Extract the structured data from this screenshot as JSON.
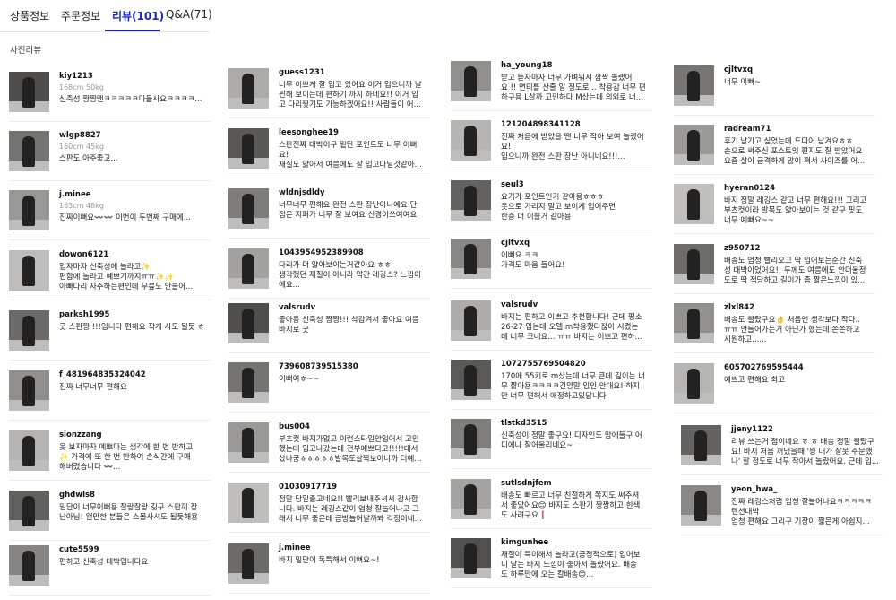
{
  "tabs": [
    {
      "label": "상품정보"
    },
    {
      "label": "주문정보"
    },
    {
      "label": "리뷰(101)"
    },
    {
      "label": "Q&A(71)"
    }
  ],
  "section_title": "사진리뷰",
  "reviews": [
    {
      "user": "kiy1213",
      "info": "168cm 50kg",
      "text": "신축성 짱짱맨ㅋㅋㅋㅋㅋ다들사요ㅋㅋㅋㅋ..."
    },
    {
      "user": "wlgp8827",
      "info": "160cm 45kg",
      "text": "스판도 아주좋고..."
    },
    {
      "user": "j.minee",
      "info": "163cm 48kg",
      "text": "진짜이뻐요〰️〰️ 이번이 두번째 구매에..."
    },
    {
      "user": "dowon6121",
      "info": "",
      "text": "입자마자 신축성에 놀라고✨\n편함에 놀라고 예쁘기까지ㅠㅠ✨✨\n아빠다리 자주하는편인데 무릎도 안늘어..."
    },
    {
      "user": "parksh1995",
      "info": "",
      "text": "굿 스판짱 !!!입니다 편해요 작게 사도 될듯 ㅎ"
    },
    {
      "user": "f_481964835324042",
      "info": "",
      "text": "진짜 너무너무 편해요"
    },
    {
      "user": "sionzzang",
      "info": "",
      "text": "옷 보자마자 예쁘다는 생각에 한 번 반하고\n✨ 가격에 또 한 번 반하여 손식간에 구매\n해버렸습니다 〰️..."
    },
    {
      "user": "ghdwls8",
      "info": "",
      "text": "밑단이 너무이뻐용 찰랑찰랑 긺구 스판끼 장\n난아님! 왠만한 분들은 스몰사셔도 될듯해용"
    },
    {
      "user": "cute5599",
      "info": "",
      "text": "편하고 신축성 대박입니다요"
    },
    {
      "user": "guess1231",
      "info": "",
      "text": "너무 이쁘게 잘 입고 있어요 이거 입으니까 날\n씬해 보이는데 편하기 까지 하네요!! 이거 입\n고 다리찢기도 가능하겠어요!! 사람들이 어..."
    },
    {
      "user": "leesonghee19",
      "info": "",
      "text": "스판진짜 대박이구 밑단 포인트도 너무 이뻐\n요!\n재질도 얇아서 여름에도 잘 입고다닐것같아..."
    },
    {
      "user": "wldnjsdldy",
      "info": "",
      "text": "너무너무 편해요 완전 스판 장난아니예요 단\n점은 지퍼가 너무 잘 보여요 신경이쓰여여요"
    },
    {
      "user": "1043954952389908",
      "info": "",
      "text": "다리가 더 얇아보이는거같아요 ㅎㅎ\n생각했던 재질이 아니라 약간 레깅스? 느낌이\n에요..."
    },
    {
      "user": "valsrudv",
      "info": "",
      "text": "좋아용 신축성 짱짱!!! 착감겨서 좋아요 여름\n바지로 굿"
    },
    {
      "user": "739608739515380",
      "info": "",
      "text": "이뻐여ㅎ~~"
    },
    {
      "user": "bus004",
      "info": "",
      "text": "부츠컷 바지가없고 이런스타일안입어서 고민\n했는데 입고나갔는데 전부예쁘다고!!!!!대서\n샀나궁ㅎㅎㅎㅎㅎ발목도살짝보이니까 더예..."
    },
    {
      "user": "01030917719",
      "info": "",
      "text": "정말 당일출고네요!! 빨리보내주셔서 감사합\n니다. 바지는 레깅스같이 엄청 잘늘어나고 그\n래서 너무 좋은데 금방늘어날까봐 걱정이네..."
    },
    {
      "user": "j.minee",
      "info": "",
      "text": "바지 밑단이 독특해서 이뻐요~!"
    },
    {
      "user": "ha_young18",
      "info": "",
      "text": "받고 뜯자마자 너무 가벼워서 깜짝 놀랬어\n요 !! 면티를 산줄 알 정도로 .. 착용감 너무 편\n하구용 L살까 고민하다 M샀는데 의외로 너..."
    },
    {
      "user": "121204898341128",
      "info": "",
      "text": "진짜 처음에 받았을 땐 너무 작아 보여 놀랬어\n요!\n입으니까 완전 스판 장난 아니네요!!!..."
    },
    {
      "user": "seul3",
      "info": "",
      "text": "요기가 포인트인거 같아용ㅎㅎㅎ\n옷으로 가리지 말고 보이게 입어주면\n한층 더 이쁠거 같아용"
    },
    {
      "user": "cjltvxq",
      "info": "",
      "text": "이뻐요 ㅋㅋ\n가격도 마음 들어요!"
    },
    {
      "user": "valsrudv",
      "info": "",
      "text": "바지는 편하고 이쁘고 추천합니다! 근데 평소\n26-27 입는데 오델 m착용했다잖아 시켰는\n데 너무 크네요... ㅠㅠ 바지는 이쁘고 편하..."
    },
    {
      "user": "1072755769504820",
      "info": "",
      "text": "170에 55키로 m샀는데 너무 큰데 길이는 너\n무 짧아용ㅋㅋㅋㅋ긴양말 입인 안대요! 하지\n만 너무 편해서 애정하고있답니다"
    },
    {
      "user": "tlstkd3515",
      "info": "",
      "text": "신축성이 정말 좋구요! 디자인도 맘에들구 어\n디에나 잘어울리네요~"
    },
    {
      "user": "sutlsdnjfem",
      "info": "",
      "text": "배송도 빠르고 너무 친절하게 쪽지도 써주셔\n서 좋았어요😊 바지도 스판기 짱짱하고 힌색\n도 사려구요❗"
    },
    {
      "user": "kimgunhee",
      "info": "",
      "text": "재질이 특이해서 놀라고(긍정적으로) 입어보\n니 달는 바지 느낌이 좋아서 놀랐어요.  배송\n도 하루만에 오는 칼배송😊..."
    },
    {
      "user": "cjltvxq",
      "info": "",
      "text": "너무 이뻐~"
    },
    {
      "user": "radream71",
      "info": "",
      "text": "후기 남기고 싶었는데 드디어 남겨요ㅎㅎ\n손으로 써주신 포스트잇 편지도 잘 받았어요\n요즘 살이 급격하게 많이 쪄서 사이즈를 어..."
    },
    {
      "user": "hyeran0124",
      "info": "",
      "text": "바지 정말 레깅스 같고 너무 편해요!!! 그리고\n부츠컷이라 발목도 얇아보이는 것 같구 핏도\n너무 예뻐요~~"
    },
    {
      "user": "z950712",
      "info": "",
      "text": "배송도 엄청 빨리오고 딱 입어보는순간 신축\n성 대박이었어요!! 두께도 여름에도 안더울정\n도로 딱 적당하고 길이가 좀 짧은느낌이 있..."
    },
    {
      "user": "zlxl842",
      "info": "",
      "text": "배송도 빨랐구요👌 처음엔 생각보다 작다..\nㅠㅠ 안들어가는거 아닌가 했는데 쫀쫀하고\n시원하고......"
    },
    {
      "user": "605702769595444",
      "info": "",
      "text": "예쁘고 편해요 최고"
    },
    {
      "user": "jjeny1122",
      "info": "",
      "text": "리뷰 쓰는거 첨이네요 ㅎ ㅎ 배송 정말 빨랐구\n요! 바지 처음 꺼냈을때 '읭 내가 잘못 주문했\n나' 할 정도로 너무 작아서 놀랐어요. 근데 입..."
    },
    {
      "user": "yeon_hwa_",
      "info": "",
      "text": "진짜 레깅스처럼 엄청 잘늘어나요ㅋㅋㅋㅋㅋ\n텐션대박\n엄청 편해요 그리구 기장이 짧은게 아쉽지..."
    }
  ]
}
